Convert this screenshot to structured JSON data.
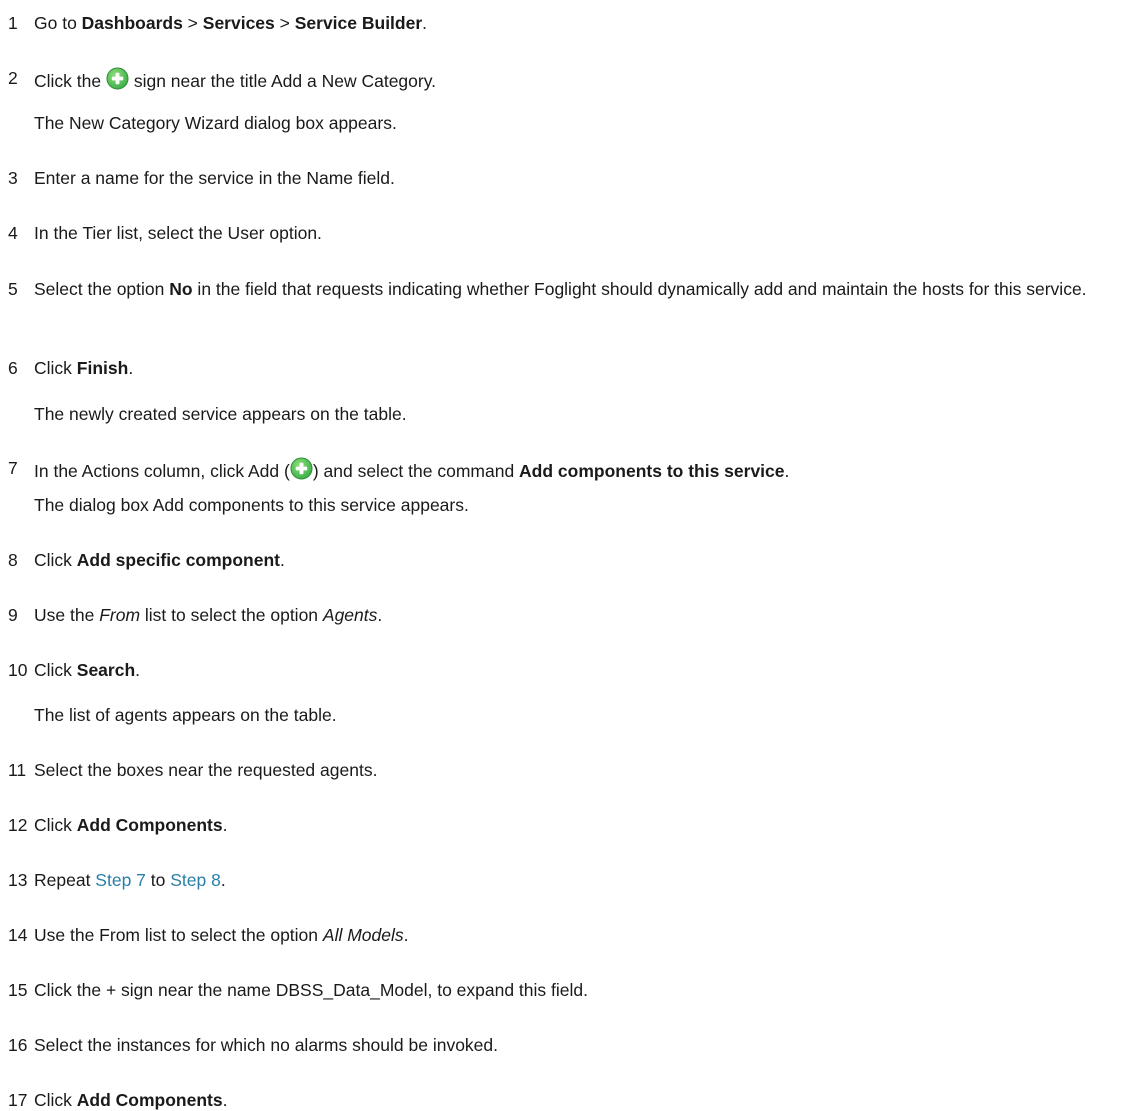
{
  "steps": [
    {
      "num": "1",
      "parts": [
        [
          "t",
          "Go to "
        ],
        [
          "b",
          "Dashboards"
        ],
        [
          "t",
          " > "
        ],
        [
          "b",
          "Services"
        ],
        [
          "t",
          " > "
        ],
        [
          "b",
          "Service Builder"
        ],
        [
          "t",
          "."
        ]
      ]
    },
    {
      "num": "2",
      "parts": [
        [
          "t",
          "Click the "
        ],
        [
          "icon",
          "plus-icon"
        ],
        [
          "t",
          " sign near the title Add a New Category."
        ]
      ],
      "note": "The New Category Wizard dialog box appears."
    },
    {
      "num": "3",
      "parts": [
        [
          "t",
          "Enter a name for the service in the Name field."
        ]
      ]
    },
    {
      "num": "4",
      "parts": [
        [
          "t",
          "In the Tier list, select the User option."
        ]
      ]
    },
    {
      "num": "5",
      "parts": [
        [
          "t",
          "Select the option "
        ],
        [
          "b",
          "No"
        ],
        [
          "t",
          " in the field that requests indicating whether Foglight should dynamically add and maintain the hosts for this service."
        ]
      ]
    },
    {
      "num": "6",
      "parts": [
        [
          "t",
          "Click "
        ],
        [
          "b",
          "Finish"
        ],
        [
          "t",
          "."
        ]
      ],
      "note": "The newly created service appears on the table."
    },
    {
      "num": "7",
      "parts": [
        [
          "t",
          "In the Actions column, click Add ("
        ],
        [
          "icon",
          "plus-icon"
        ],
        [
          "t",
          ") and select the command "
        ],
        [
          "b",
          "Add components to this service"
        ],
        [
          "t",
          "."
        ]
      ],
      "note": "The dialog box Add components to this service appears."
    },
    {
      "num": "8",
      "parts": [
        [
          "t",
          "Click "
        ],
        [
          "b",
          "Add specific component"
        ],
        [
          "t",
          "."
        ]
      ]
    },
    {
      "num": "9",
      "parts": [
        [
          "t",
          "Use the "
        ],
        [
          "i",
          "From"
        ],
        [
          "t",
          " list to select the option "
        ],
        [
          "i",
          "Agents"
        ],
        [
          "t",
          "."
        ]
      ]
    },
    {
      "num": "10",
      "parts": [
        [
          "t",
          "Click "
        ],
        [
          "b",
          "Search"
        ],
        [
          "t",
          "."
        ]
      ],
      "note": "The list of agents appears on the table."
    },
    {
      "num": "11",
      "parts": [
        [
          "t",
          "Select the boxes near the requested agents."
        ]
      ]
    },
    {
      "num": "12",
      "parts": [
        [
          "t",
          "Click "
        ],
        [
          "b",
          "Add Components"
        ],
        [
          "t",
          "."
        ]
      ]
    },
    {
      "num": "13",
      "parts": [
        [
          "t",
          "Repeat "
        ],
        [
          "link",
          "Step 7"
        ],
        [
          "t",
          " to "
        ],
        [
          "link",
          "Step 8"
        ],
        [
          "t",
          "."
        ]
      ]
    },
    {
      "num": "14",
      "parts": [
        [
          "t",
          "Use the From list to select the option "
        ],
        [
          "i",
          "All Models"
        ],
        [
          "t",
          "."
        ]
      ]
    },
    {
      "num": "15",
      "parts": [
        [
          "t",
          "Click the + sign near the name DBSS_Data_Model, to expand this field."
        ]
      ]
    },
    {
      "num": "16",
      "parts": [
        [
          "t",
          "Select the instances for which no alarms should be invoked."
        ]
      ]
    },
    {
      "num": "17",
      "parts": [
        [
          "t",
          "Click "
        ],
        [
          "b",
          "Add Components"
        ],
        [
          "t",
          "."
        ]
      ]
    }
  ],
  "colors": {
    "link": "#2a7fa8",
    "icon_green": "#3db04a",
    "text": "#1a1a1a"
  }
}
